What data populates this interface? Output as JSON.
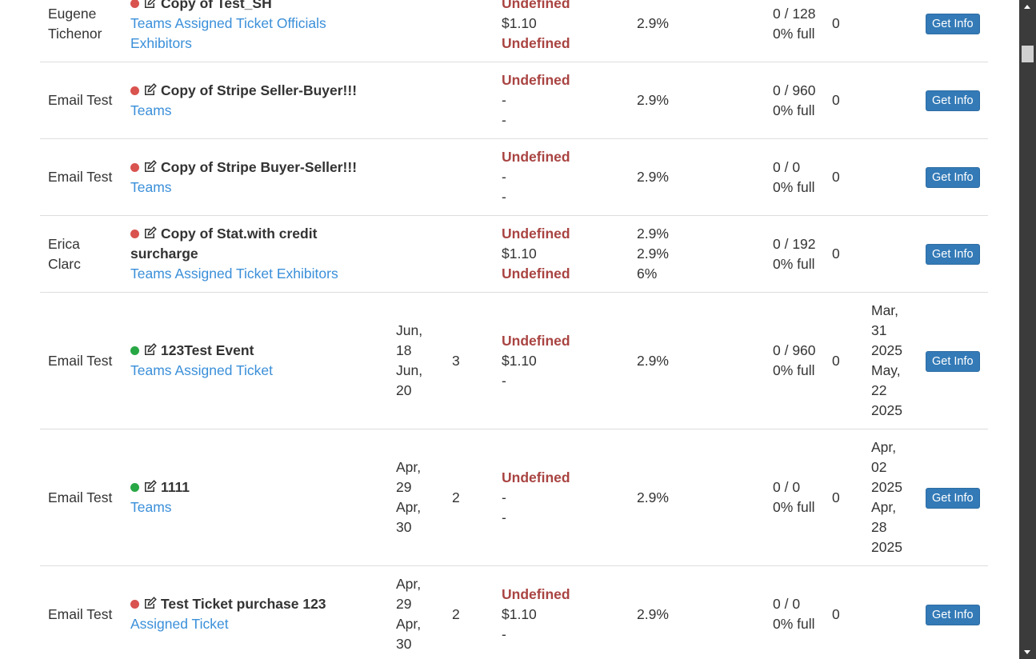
{
  "button_label": "Get Info",
  "rows": [
    {
      "owner": [
        "Eugene",
        "Tichenor"
      ],
      "status": "red",
      "title": "Copy of Test_SH",
      "tags": [
        "Teams Assigned Ticket Officials",
        "Exhibitors"
      ],
      "dates": [],
      "days": "",
      "price": [
        "Undefined",
        "$1.10",
        "Undefined"
      ],
      "fee": [
        "2.9%"
      ],
      "cap": [
        "0 / 128",
        "0% full"
      ],
      "sold": "0",
      "sale": []
    },
    {
      "owner": [
        "Email Test"
      ],
      "status": "red",
      "title": "Copy of Stripe Seller-Buyer!!!",
      "tags": [
        "Teams"
      ],
      "dates": [],
      "days": "",
      "price": [
        "Undefined",
        "-",
        "-"
      ],
      "fee": [
        "2.9%"
      ],
      "cap": [
        "0 / 960",
        "0% full"
      ],
      "sold": "0",
      "sale": []
    },
    {
      "owner": [
        "Email Test"
      ],
      "status": "red",
      "title": "Copy of Stripe Buyer-Seller!!!",
      "tags": [
        "Teams"
      ],
      "dates": [],
      "days": "",
      "price": [
        "Undefined",
        "-",
        "-"
      ],
      "fee": [
        "2.9%"
      ],
      "cap": [
        "0 / 0",
        "0% full"
      ],
      "sold": "0",
      "sale": []
    },
    {
      "owner": [
        "Erica",
        "Clarc"
      ],
      "status": "red",
      "title": "Copy of Stat.with credit surcharge",
      "tags": [
        "Teams Assigned Ticket Exhibitors"
      ],
      "dates": [],
      "days": "",
      "price": [
        "Undefined",
        "$1.10",
        "Undefined"
      ],
      "fee": [
        "2.9%",
        "2.9%",
        "6%"
      ],
      "cap": [
        "0 / 192",
        "0% full"
      ],
      "sold": "0",
      "sale": []
    },
    {
      "owner": [
        "Email Test"
      ],
      "status": "green",
      "title": "123Test Event",
      "tags": [
        "Teams Assigned Ticket"
      ],
      "dates": [
        "Jun,",
        "18",
        "Jun,",
        "20"
      ],
      "days": "3",
      "price": [
        "Undefined",
        "$1.10",
        "-"
      ],
      "fee": [
        "2.9%"
      ],
      "cap": [
        "0 / 960",
        "0% full"
      ],
      "sold": "0",
      "sale": [
        "Mar,",
        "31",
        "2025",
        "May,",
        "22",
        "2025"
      ]
    },
    {
      "owner": [
        "Email Test"
      ],
      "status": "green",
      "title": "1111",
      "tags": [
        "Teams"
      ],
      "dates": [
        "Apr,",
        "29",
        "Apr,",
        "30"
      ],
      "days": "2",
      "price": [
        "Undefined",
        "-",
        "-"
      ],
      "fee": [
        "2.9%"
      ],
      "cap": [
        "0 / 0",
        "0% full"
      ],
      "sold": "0",
      "sale": [
        "Apr,",
        "02",
        "2025",
        "Apr,",
        "28",
        "2025"
      ]
    },
    {
      "owner": [
        "Email Test"
      ],
      "status": "red",
      "title": "Test Ticket purchase 123",
      "tags": [
        "Assigned Ticket"
      ],
      "dates": [
        "Apr,",
        "29",
        "Apr,",
        "30"
      ],
      "days": "2",
      "price": [
        "Undefined",
        "$1.10",
        "-"
      ],
      "fee": [
        "2.9%"
      ],
      "cap": [
        "0 / 0",
        "0% full"
      ],
      "sold": "0",
      "sale": []
    }
  ],
  "colors": {
    "link": "#3a8fd9",
    "undefined": "#a94442",
    "status_red": "#d9534f",
    "status_green": "#28a745",
    "button": "#337ab7"
  },
  "icons": {
    "edit": "edit-icon",
    "status": "status-dot-icon"
  }
}
